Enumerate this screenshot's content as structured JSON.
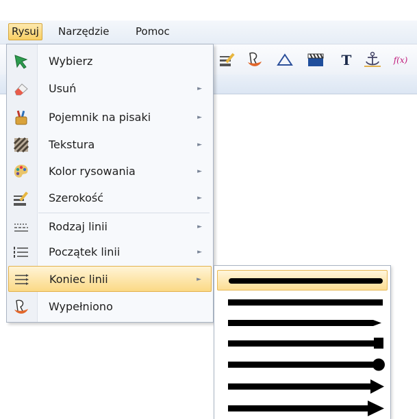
{
  "menubar": {
    "items": [
      {
        "label": "Rysuj",
        "active": true
      },
      {
        "label": "Narzędzie",
        "active": false
      },
      {
        "label": "Pomoc",
        "active": false
      }
    ]
  },
  "toolbar_icons": [
    "pen-icon",
    "line-width-icon",
    "fill-icon",
    "triangle-icon",
    "clapperboard-icon",
    "text-tool-icon",
    "anchor-icon",
    "function-icon"
  ],
  "toolbar": {
    "function_glyph": "f(x)",
    "text_glyph": "T"
  },
  "draw_menu": {
    "items": [
      {
        "label": "Wybierz",
        "icon": "select-arrow-icon",
        "submenu": false
      },
      {
        "label": "Usuń",
        "icon": "eraser-icon",
        "submenu": true
      },
      {
        "label": "Pojemnik na pisaki",
        "icon": "pen-holder-icon",
        "submenu": true
      },
      {
        "label": "Tekstura",
        "icon": "texture-icon",
        "submenu": true
      },
      {
        "label": "Kolor rysowania",
        "icon": "color-palette-icon",
        "submenu": true
      },
      {
        "label": "Szerokość",
        "icon": "line-width-icon",
        "submenu": true
      },
      {
        "label": "Rodzaj linii",
        "icon": "line-style-icon",
        "submenu": true
      },
      {
        "label": "Początek linii",
        "icon": "line-start-icon",
        "submenu": true
      },
      {
        "label": "Koniec linii",
        "icon": "line-end-icon",
        "submenu": true,
        "highlighted": true
      },
      {
        "label": "Wypełniono",
        "icon": "fill-icon",
        "submenu": false
      }
    ]
  },
  "line_end_submenu": {
    "options": [
      {
        "name": "rounded-end",
        "selected": true
      },
      {
        "name": "flat-end",
        "selected": false
      },
      {
        "name": "pointed-end",
        "selected": false
      },
      {
        "name": "square-end",
        "selected": false
      },
      {
        "name": "circle-end",
        "selected": false
      },
      {
        "name": "diamond-end",
        "selected": false
      },
      {
        "name": "arrow-end",
        "selected": false
      }
    ]
  },
  "colors": {
    "highlight": "#fbd985",
    "highlight_border": "#e2b14c",
    "menu_bg": "#f7f9fc",
    "line_color": "#000000"
  }
}
